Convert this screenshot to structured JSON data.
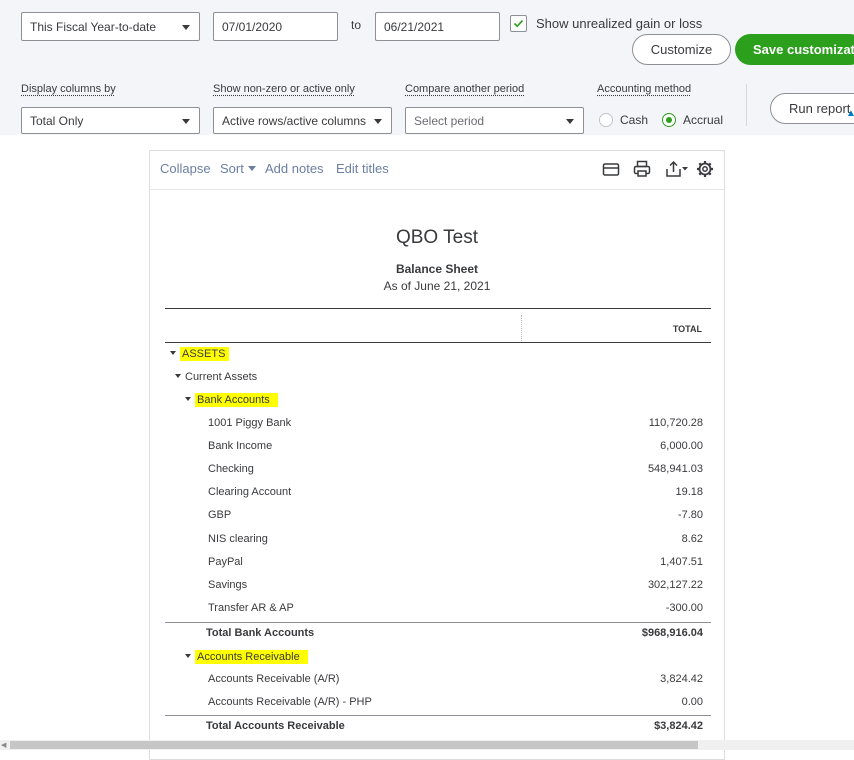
{
  "filters": {
    "date_range": "This Fiscal Year-to-date",
    "start_date": "07/01/2020",
    "to_label": "to",
    "end_date": "06/21/2021",
    "unrealized_label": "Show unrealized gain or loss",
    "unrealized_checked": true,
    "customize_label": "Customize",
    "save_label": "Save customizatio",
    "display_columns_label": "Display columns by",
    "display_columns_value": "Total Only",
    "nonzero_label": "Show non-zero or active only",
    "nonzero_value": "Active rows/active columns",
    "compare_label": "Compare another period",
    "compare_value": "Select period",
    "method_label": "Accounting method",
    "method_cash": "Cash",
    "method_accrual": "Accrual",
    "method_selected": "Accrual",
    "run_label": "Run report"
  },
  "toolbar": {
    "collapse": "Collapse",
    "sort": "Sort",
    "add_notes": "Add notes",
    "edit_titles": "Edit titles",
    "icons": [
      "email-icon",
      "print-icon",
      "export-icon",
      "settings-icon"
    ]
  },
  "report": {
    "company": "QBO Test",
    "title": "Balance Sheet",
    "subtitle": "As of June 21, 2021",
    "column_header": "TOTAL",
    "rows": {
      "assets": "ASSETS",
      "current_assets": "Current Assets",
      "bank_accounts": "Bank Accounts",
      "piggy": {
        "name": "1001 Piggy Bank",
        "value": "110,720.28"
      },
      "bank_income": {
        "name": "Bank Income",
        "value": "6,000.00"
      },
      "checking": {
        "name": "Checking",
        "value": "548,941.03"
      },
      "clearing": {
        "name": "Clearing Account",
        "value": "19.18"
      },
      "gbp": {
        "name": "GBP",
        "value": "-7.80"
      },
      "nis": {
        "name": "NIS clearing",
        "value": "8.62"
      },
      "paypal": {
        "name": "PayPal",
        "value": "1,407.51"
      },
      "savings": {
        "name": "Savings",
        "value": "302,127.22"
      },
      "transfer": {
        "name": "Transfer AR & AP",
        "value": "-300.00"
      },
      "total_bank": {
        "name": "Total Bank Accounts",
        "value": "$968,916.04"
      },
      "ar": "Accounts Receivable",
      "ar_ar": {
        "name": "Accounts Receivable (A/R)",
        "value": "3,824.42"
      },
      "ar_php": {
        "name": "Accounts Receivable (A/R) - PHP",
        "value": "0.00"
      },
      "total_ar": {
        "name": "Total Accounts Receivable",
        "value": "$3,824.42"
      }
    }
  },
  "colors": {
    "brand_green": "#2ca01c",
    "highlight": "#ffff00",
    "link": "#6b7fa3"
  }
}
